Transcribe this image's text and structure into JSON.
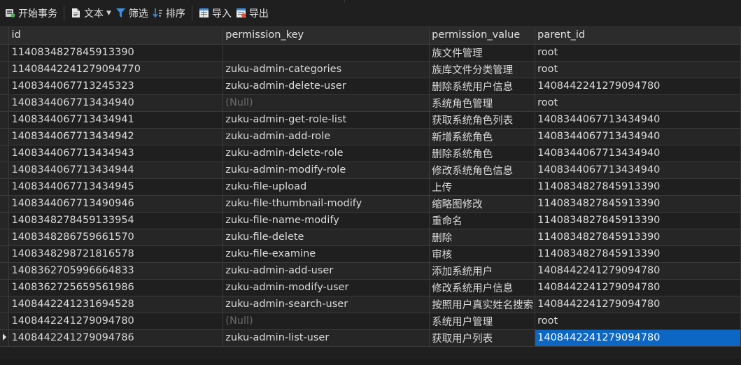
{
  "toolbar": {
    "begin_transaction": "开始事务",
    "text": "文本",
    "filter": "筛选",
    "sort": "排序",
    "import": "导入",
    "export": "导出"
  },
  "columns": [
    "id",
    "permission_key",
    "permission_value",
    "parent_id"
  ],
  "rows": [
    [
      "1140834827845913390",
      "",
      "族文件管理",
      "root"
    ],
    [
      "11408442241279094770",
      "zuku-admin-categories",
      "族库文件分类管理",
      "root"
    ],
    [
      "1408344067713245323",
      "zuku-admin-delete-user",
      "删除系统用户信息",
      "1408442241279094780"
    ],
    [
      "1408344067713434940",
      "(Null)",
      "系统角色管理",
      "root"
    ],
    [
      "1408344067713434941",
      "zuku-admin-get-role-list",
      "获取系统角色列表",
      "1408344067713434940"
    ],
    [
      "1408344067713434942",
      "zuku-admin-add-role",
      "新增系统角色",
      "1408344067713434940"
    ],
    [
      "1408344067713434943",
      "zuku-admin-delete-role",
      "删除系统角色",
      "1408344067713434940"
    ],
    [
      "1408344067713434944",
      "zuku-admin-modify-role",
      "修改系统角色信息",
      "1408344067713434940"
    ],
    [
      "1408344067713434945",
      "zuku-file-upload",
      "上传",
      "1140834827845913390"
    ],
    [
      "1408344067713490946",
      "zuku-file-thumbnail-modify",
      "缩略图修改",
      "1140834827845913390"
    ],
    [
      "1408348278459133954",
      "zuku-file-name-modify",
      "重命名",
      "1140834827845913390"
    ],
    [
      "1408348286759661570",
      "zuku-file-delete",
      "删除",
      "1140834827845913390"
    ],
    [
      "1408348298721816578",
      "zuku-file-examine",
      "审核",
      "1140834827845913390"
    ],
    [
      "1408362705996664833",
      "zuku-admin-add-user",
      "添加系统用户",
      "1408442241279094780"
    ],
    [
      "1408362725659561986",
      "zuku-admin-modify-user",
      "修改系统用户信息",
      "1408442241279094780"
    ],
    [
      "1408442241231694528",
      "zuku-admin-search-user",
      "按照用户真实姓名搜索",
      "1408442241279094780"
    ],
    [
      "1408442241279094780",
      "(Null)",
      "系统用户管理",
      "root"
    ],
    [
      "1408442241279094786",
      "zuku-admin-list-user",
      "获取用户列表",
      "1408442241279094780"
    ]
  ],
  "current_row": 17,
  "selected_cell": [
    17,
    3
  ],
  "colors": {
    "selection": "#0b67c3",
    "null_text": "#6a6a6a",
    "filter_icon": "#3d8ee0"
  }
}
